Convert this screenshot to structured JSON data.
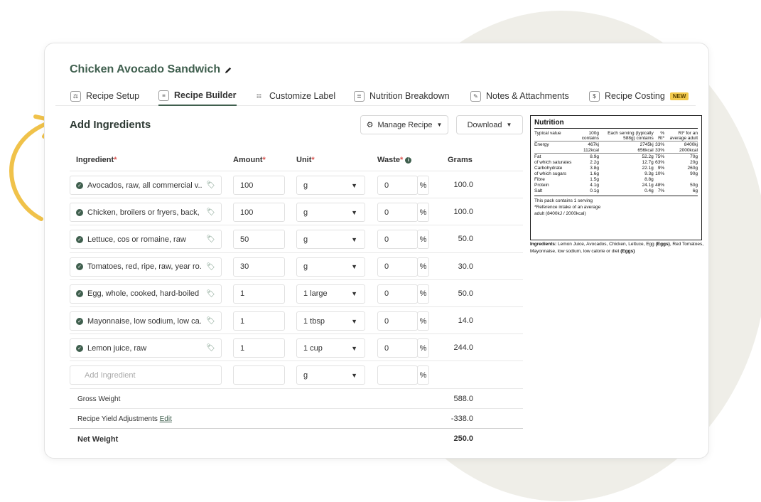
{
  "recipe": {
    "title": "Chicken Avocado Sandwich"
  },
  "tabs": [
    {
      "label": "Recipe Setup",
      "icon": "scale-icon"
    },
    {
      "label": "Recipe Builder",
      "icon": "document-icon",
      "active": true
    },
    {
      "label": "Customize Label",
      "icon": "sliders-icon"
    },
    {
      "label": "Nutrition Breakdown",
      "icon": "clipboard-icon"
    },
    {
      "label": "Notes & Attachments",
      "icon": "note-icon"
    },
    {
      "label": "Recipe Costing",
      "icon": "receipt-icon",
      "badge": "NEW"
    }
  ],
  "section": {
    "title": "Add Ingredients",
    "manage_label": "Manage Recipe",
    "download_label": "Download"
  },
  "headers": {
    "ingredient": "Ingredient",
    "amount": "Amount",
    "unit": "Unit",
    "waste": "Waste",
    "grams": "Grams",
    "required_mark": "*",
    "percent": "%"
  },
  "rows": [
    {
      "name": "Avocados, raw, all commercial v...",
      "amount": "100",
      "unit": "g",
      "waste": "0",
      "grams": "100.0"
    },
    {
      "name": "Chicken, broilers or fryers, back, ...",
      "amount": "100",
      "unit": "g",
      "waste": "0",
      "grams": "100.0"
    },
    {
      "name": "Lettuce, cos or romaine, raw",
      "amount": "50",
      "unit": "g",
      "waste": "0",
      "grams": "50.0"
    },
    {
      "name": "Tomatoes, red, ripe, raw, year ro...",
      "amount": "30",
      "unit": "g",
      "waste": "0",
      "grams": "30.0"
    },
    {
      "name": "Egg, whole, cooked, hard-boiled",
      "amount": "1",
      "unit": "1 large",
      "waste": "0",
      "grams": "50.0"
    },
    {
      "name": "Mayonnaise, low sodium, low ca...",
      "amount": "1",
      "unit": "1 tbsp",
      "waste": "0",
      "grams": "14.0"
    },
    {
      "name": "Lemon juice, raw",
      "amount": "1",
      "unit": "1 cup",
      "waste": "0",
      "grams": "244.0"
    }
  ],
  "new_row": {
    "placeholder": "Add Ingredient",
    "unit": "g"
  },
  "summary": {
    "gross_label": "Gross Weight",
    "gross_value": "588.0",
    "yield_label": "Recipe Yield Adjustments",
    "yield_edit": "Edit",
    "yield_value": "-338.0",
    "net_label": "Net Weight",
    "net_value": "250.0"
  },
  "nutrition": {
    "title": "Nutrition",
    "col_typical": "Typical value",
    "col_100g": "100g",
    "col_100g_2": "contains",
    "col_serving": "Each serving (typically",
    "col_serving_2": "588g) contains",
    "col_pct": "%",
    "col_pct_2": "RI*",
    "col_ri": "RI* for an",
    "col_ri_2": "average adult",
    "rows": [
      {
        "label": "Energy",
        "per100": "467kj",
        "serving": "2745kj",
        "pct": "33%",
        "ri": "8400kj"
      },
      {
        "label": "",
        "per100": "112kcal",
        "serving": "656kcal",
        "pct": "33%",
        "ri": "2000kcal",
        "sep": true
      },
      {
        "label": "Fat",
        "per100": "8.9g",
        "serving": "52.2g",
        "pct": "75%",
        "ri": "70g"
      },
      {
        "label": "of which saturates",
        "per100": "2.2g",
        "serving": "12.7g",
        "pct": "63%",
        "ri": "20g"
      },
      {
        "label": "Carbohydrate",
        "per100": "3.8g",
        "serving": "22.1g",
        "pct": "9%",
        "ri": "260g"
      },
      {
        "label": "of which sugars",
        "per100": "1.6g",
        "serving": "9.3g",
        "pct": "10%",
        "ri": "90g"
      },
      {
        "label": "Fibre",
        "per100": "1.5g",
        "serving": "8.8g",
        "pct": "",
        "ri": ""
      },
      {
        "label": "Protein",
        "per100": "4.1g",
        "serving": "24.1g",
        "pct": "48%",
        "ri": "50g"
      },
      {
        "label": "Salt",
        "per100": "0.1g",
        "serving": "0.4g",
        "pct": "7%",
        "ri": "6g"
      }
    ],
    "foot1": "This pack contains 1 serving",
    "foot2": "*Reference intake of an average",
    "foot3": "adult (8400kJ / 2000kcal)"
  },
  "ingredients_note": {
    "label": "Ingredients:",
    "text1": "Lemon Juice, Avocados, Chicken, Lettuce, Egg",
    "allergen1": "(Eggs)",
    "text2": ", Red Tomatoes, Mayonnaise, low sodium, low calorie or diet",
    "allergen2": "(Eggs)"
  },
  "colors": {
    "brand": "#3f5f4e",
    "accent_arrow": "#f0c24a",
    "badge": "#f2c94c"
  }
}
